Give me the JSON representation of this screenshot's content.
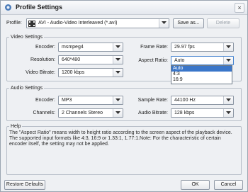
{
  "window": {
    "title": "Profile Settings",
    "close_glyph": "×"
  },
  "profile": {
    "label": "Profile:",
    "value": "AVI - Audio-Video Interleaved (*.avi)",
    "save_as": "Save as...",
    "delete": "Delete"
  },
  "video": {
    "legend": "Video Settings",
    "encoder_label": "Encoder:",
    "encoder_value": "msmpeg4",
    "resolution_label": "Resolution:",
    "resolution_value": "640*480",
    "bitrate_label": "Video Bitrate:",
    "bitrate_value": "1200 kbps",
    "framerate_label": "Frame Rate:",
    "framerate_value": "29.97 fps",
    "aspect_label": "Aspect Ratio:",
    "aspect_value": "Auto",
    "aspect_options": [
      "Auto",
      "4:3",
      "16:9"
    ]
  },
  "audio": {
    "legend": "Audio Settings",
    "encoder_label": "Encoder:",
    "encoder_value": "MP3",
    "channels_label": "Channels:",
    "channels_value": "2 Channels Stereo",
    "samplerate_label": "Sample Rate:",
    "samplerate_value": "44100 Hz",
    "bitrate_label": "Audio Bitrate:",
    "bitrate_value": "128 kbps"
  },
  "help": {
    "legend": "Help",
    "text": "The \"Aspect Ratio\" means width to height ratio according to the screen aspect of the playback device. The supported input formats like 4:3, 16:9 or 1.33:1, 1.77:1.Note: For the characteristic of certain encoder itself, the setting may not be applied."
  },
  "footer": {
    "restore": "Restore Defaults",
    "ok": "OK",
    "cancel": "Cancel"
  }
}
